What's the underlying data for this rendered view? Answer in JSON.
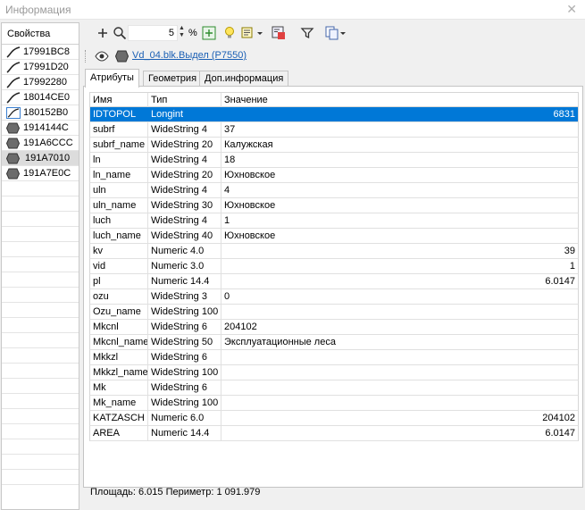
{
  "window": {
    "title": "Информация"
  },
  "left_panel": {
    "header": "Свойства",
    "objects": [
      {
        "id": "17991BC8",
        "kind": "line"
      },
      {
        "id": "17991D20",
        "kind": "line"
      },
      {
        "id": "17992280",
        "kind": "line"
      },
      {
        "id": "18014CE0",
        "kind": "line"
      },
      {
        "id": "180152B0",
        "kind": "line-active"
      },
      {
        "id": "1914144C",
        "kind": "polygon"
      },
      {
        "id": "191A6CCC",
        "kind": "polygon"
      },
      {
        "id": "191A7010",
        "kind": "polygon",
        "selected": true
      },
      {
        "id": "191A7E0C",
        "kind": "polygon"
      }
    ]
  },
  "toolbar": {
    "scale_value": "5",
    "scale_unit": "%"
  },
  "layer": {
    "link": "Vd_04.blk.Выдел  (P7550)"
  },
  "tabs": [
    {
      "label": "Атрибуты",
      "active": true
    },
    {
      "label": "Геометрия",
      "active": false
    },
    {
      "label": "Доп.информация",
      "active": false
    }
  ],
  "grid": {
    "headers": {
      "name": "Имя",
      "type": "Тип",
      "value": "Значение"
    },
    "rows": [
      {
        "name": "IDTOPOL",
        "type": "Longint",
        "value": "6831",
        "num": true,
        "selected": true
      },
      {
        "name": "subrf",
        "type": "WideString 4",
        "value": "37"
      },
      {
        "name": "subrf_name",
        "type": "WideString 20",
        "value": "Калужская"
      },
      {
        "name": "ln",
        "type": "WideString 4",
        "value": "18"
      },
      {
        "name": "ln_name",
        "type": "WideString 20",
        "value": "Юхновское"
      },
      {
        "name": "uln",
        "type": "WideString 4",
        "value": "4"
      },
      {
        "name": "uln_name",
        "type": "WideString 30",
        "value": "Юхновское"
      },
      {
        "name": "luch",
        "type": "WideString 4",
        "value": "1"
      },
      {
        "name": "luch_name",
        "type": "WideString 40",
        "value": "Юхновское"
      },
      {
        "name": "kv",
        "type": "Numeric 4.0",
        "value": "39",
        "num": true
      },
      {
        "name": "vid",
        "type": "Numeric 3.0",
        "value": "1",
        "num": true
      },
      {
        "name": "pl",
        "type": "Numeric 14.4",
        "value": "6.0147",
        "num": true
      },
      {
        "name": "ozu",
        "type": "WideString 3",
        "value": "0"
      },
      {
        "name": "Ozu_name",
        "type": "WideString 100",
        "value": ""
      },
      {
        "name": "Mkcnl",
        "type": "WideString 6",
        "value": "204102"
      },
      {
        "name": "Mkcnl_name",
        "type": "WideString 50",
        "value": "Эксплуатационные леса"
      },
      {
        "name": "Mkkzl",
        "type": "WideString 6",
        "value": ""
      },
      {
        "name": "Mkkzl_name",
        "type": "WideString 100",
        "value": ""
      },
      {
        "name": "Mk",
        "type": "WideString 6",
        "value": ""
      },
      {
        "name": "Mk_name",
        "type": "WideString 100",
        "value": ""
      },
      {
        "name": "KATZASCH",
        "type": "Numeric 6.0",
        "value": "204102",
        "num": true
      },
      {
        "name": "AREA",
        "type": "Numeric 14.4",
        "value": "6.0147",
        "num": true
      }
    ]
  },
  "status": {
    "text": "Площадь: 6.015  Периметр: 1 091.979"
  },
  "colors": {
    "selection": "#0078d7",
    "link": "#1a5fb4"
  },
  "icons": [
    "close-icon",
    "add-icon",
    "zoom-icon",
    "spin-arrows-icon",
    "zoom-extent-icon",
    "bulb-icon",
    "edit-layer-icon",
    "layer-settings-icon",
    "filter-icon",
    "copy-icon",
    "eye-icon",
    "polygon-icon",
    "line-icon"
  ]
}
